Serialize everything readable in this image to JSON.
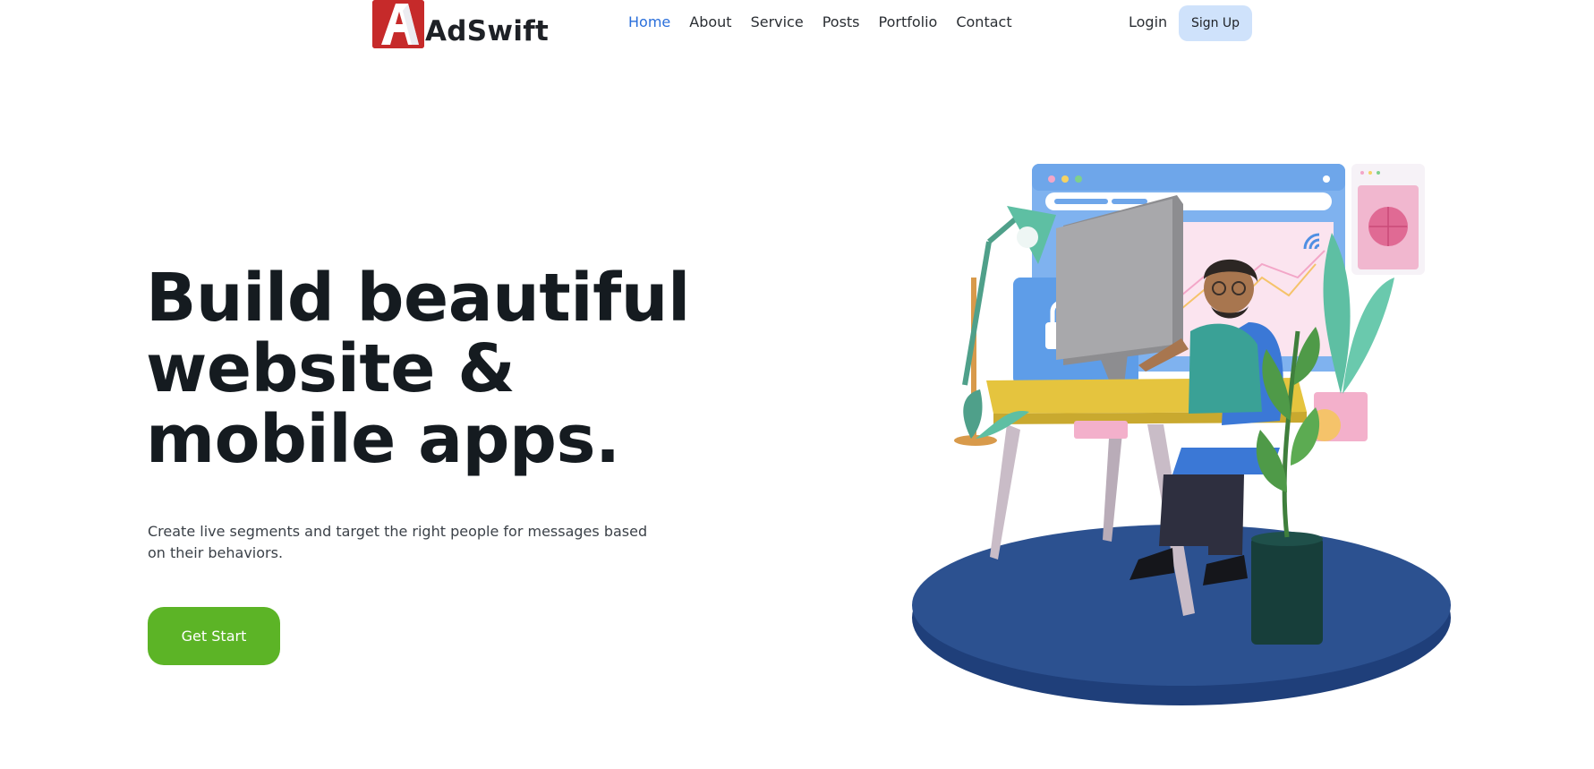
{
  "brand": {
    "name": "AdSwift",
    "mark_letter": "A",
    "color": "#c62a2a"
  },
  "nav": {
    "items": [
      {
        "label": "Home",
        "active": true
      },
      {
        "label": "About",
        "active": false
      },
      {
        "label": "Service",
        "active": false
      },
      {
        "label": "Posts",
        "active": false
      },
      {
        "label": "Portfolio",
        "active": false
      },
      {
        "label": "Contact",
        "active": false
      }
    ],
    "active_color": "#2a6fdb"
  },
  "auth": {
    "login_label": "Login",
    "signup_label": "Sign Up",
    "signup_bg": "#cfe2fb"
  },
  "hero": {
    "title_lines": [
      "Build beautiful",
      "website &",
      "mobile apps."
    ],
    "subtitle": "Create live segments and target the right people for messages based on their behaviors.",
    "cta_label": "Get Start",
    "cta_color": "#5cb426"
  },
  "illustration": {
    "icon": "person-at-desk-illustration"
  }
}
